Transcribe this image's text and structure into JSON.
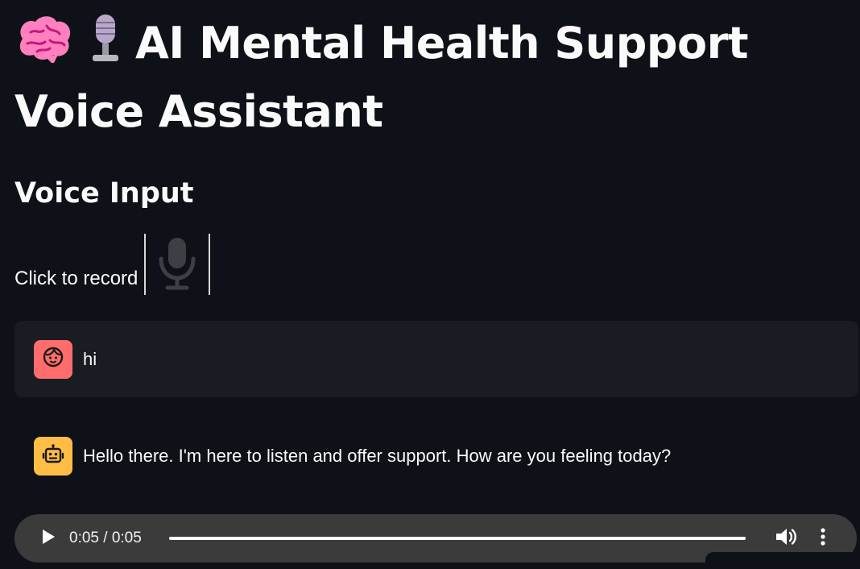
{
  "header": {
    "title": "AI Mental Health Support Voice Assistant",
    "title_icons": [
      "brain-icon",
      "microphone-emoji-icon"
    ]
  },
  "voice_input": {
    "subheader": "Voice Input",
    "record_label": "Click to record",
    "record_icon": "microphone-icon"
  },
  "chat": {
    "messages": [
      {
        "role": "user",
        "avatar_icon": "user-face-icon",
        "text": "hi"
      },
      {
        "role": "assistant",
        "avatar_icon": "robot-icon",
        "text": "Hello there. I'm here to listen and offer support. How are you feeling today?"
      }
    ]
  },
  "audio_player": {
    "time": "0:05 / 0:05",
    "progress": 1.0,
    "play_icon": "play-icon",
    "volume_icon": "volume-icon",
    "more_icon": "more-options-icon"
  },
  "colors": {
    "background": "#0e1117",
    "user_avatar": "#ff6c6c",
    "assistant_avatar": "#ffbd45",
    "user_message_bg": "#1a1c24",
    "player_bg": "#3b3b3b"
  }
}
